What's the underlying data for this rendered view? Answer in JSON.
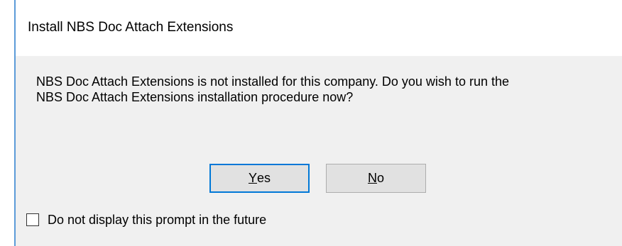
{
  "dialog": {
    "title": "Install NBS Doc Attach Extensions",
    "message_line1": "NBS Doc Attach Extensions is not installed for this company. Do you wish to run the",
    "message_line2": "NBS Doc Attach Extensions installation procedure now?",
    "buttons": {
      "yes": {
        "accel": "Y",
        "rest": "es"
      },
      "no": {
        "accel": "N",
        "rest": "o"
      }
    },
    "checkbox": {
      "label": "Do not display this prompt in the future",
      "checked": false
    }
  },
  "colors": {
    "focus_border": "#0078d7",
    "frame_accent": "#5c9bd8",
    "dialog_bg": "#f0f0f0",
    "button_bg": "#e1e1e1"
  }
}
